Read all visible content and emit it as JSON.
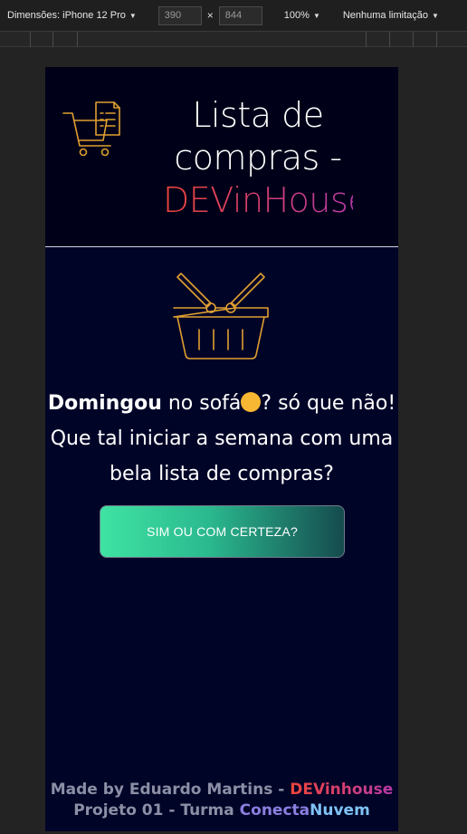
{
  "devtools": {
    "dimensions_label": "Dimensões: iPhone 12 Pro",
    "width_value": "390",
    "height_value": "844",
    "times": "×",
    "zoom": "100%",
    "throttle": "Nenhuma limitação"
  },
  "header": {
    "title_line": "Lista de compras -",
    "title_brand": "DEVinHouse"
  },
  "message": {
    "bold": "Domingou",
    "part1": " no sofá",
    "part2": "? só que não! Que tal iniciar a semana com uma bela lista de compras?"
  },
  "cta": {
    "label": "SIM OU COM CERTEZA?"
  },
  "footer": {
    "line1_prefix": "Made by Eduardo Martins - ",
    "line1_brand": "DEVinhouse",
    "line2_prefix": "Projeto 01 - Turma ",
    "line2_c1": "Conecta",
    "line2_c2": "Nuvem"
  },
  "colors": {
    "background": "#000427",
    "header_bg": "#000118",
    "icon_stroke": "#e0a030",
    "cta_start": "#3fe3a3",
    "cta_end": "#154b4e",
    "brand_start": "#f0443a",
    "brand_end": "#b83aa6"
  }
}
